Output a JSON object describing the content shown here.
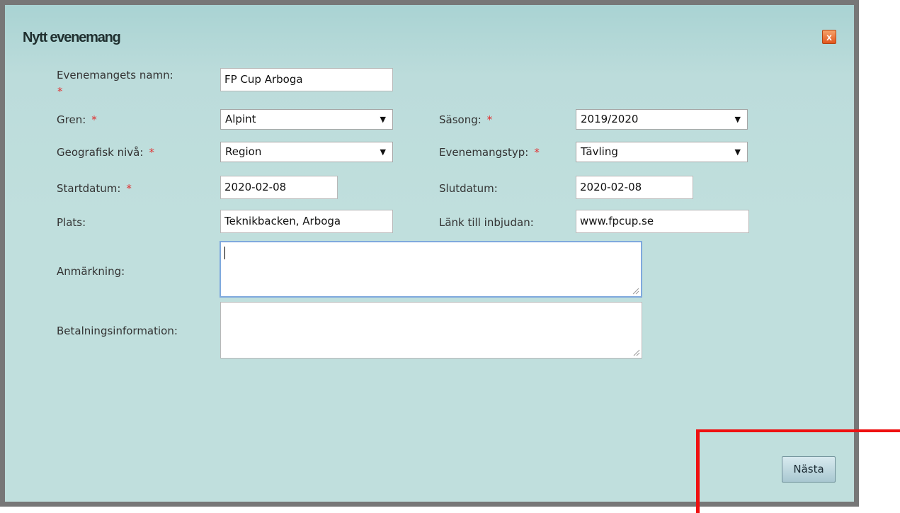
{
  "dialog": {
    "title": "Nytt evenemang",
    "close_label": "x",
    "next_label": "Nästa"
  },
  "required_marker": "*",
  "fields": {
    "event_name": {
      "label": "Evenemangets namn:",
      "value": "FP Cup Arboga",
      "required": true
    },
    "gren": {
      "label": "Gren:",
      "value": "Alpint",
      "required": true
    },
    "sasong": {
      "label": "Säsong:",
      "value": "2019/2020",
      "required": true
    },
    "geo_level": {
      "label": "Geografisk nivå:",
      "value": "Region",
      "required": true
    },
    "event_type": {
      "label": "Evenemangstyp:",
      "value": "Tävling",
      "required": true
    },
    "start_date": {
      "label": "Startdatum:",
      "value": "2020-02-08",
      "required": true
    },
    "end_date": {
      "label": "Slutdatum:",
      "value": "2020-02-08",
      "required": false
    },
    "plats": {
      "label": "Plats:",
      "value": "Teknikbacken, Arboga",
      "required": false
    },
    "invite_link": {
      "label": "Länk till inbjudan:",
      "value": "www.fpcup.se",
      "required": false
    },
    "anmarkning": {
      "label": "Anmärkning:",
      "value": ""
    },
    "betalning": {
      "label": "Betalningsinformation:",
      "value": ""
    }
  },
  "colors": {
    "required": "#e03030",
    "annotation": "#ee1111",
    "focus": "#7fa9dd"
  }
}
